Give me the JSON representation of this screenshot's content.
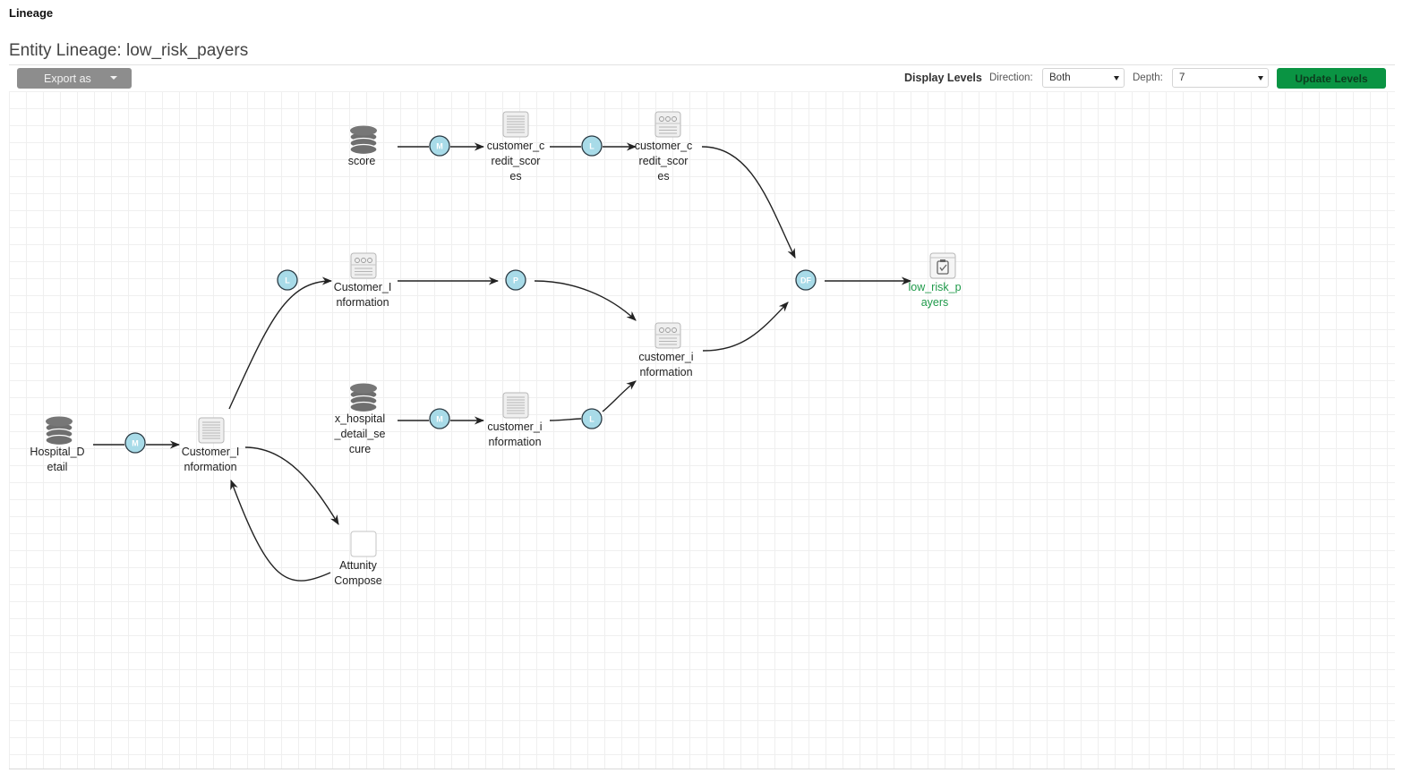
{
  "header": {
    "section_title": "Lineage",
    "page_title": "Entity Lineage: low_risk_payers"
  },
  "toolbar": {
    "export_label": "Export as",
    "display_levels_label": "Display Levels",
    "direction_label": "Direction:",
    "direction_value": "Both",
    "depth_label": "Depth:",
    "depth_value": "7",
    "update_label": "Update Levels"
  },
  "colors": {
    "process_fill": "#a8dbe8",
    "target_text": "#1f9a4a",
    "update_button": "#0a9443",
    "export_button": "#8d8d8d"
  },
  "graph": {
    "entities": [
      {
        "id": "score",
        "icon": "database-icon",
        "lines": [
          "score"
        ]
      },
      {
        "id": "ccs1",
        "icon": "table-icon",
        "lines": [
          "customer_c",
          "redit_scor",
          "es"
        ]
      },
      {
        "id": "ccs2",
        "icon": "view-icon",
        "lines": [
          "customer_c",
          "redit_scor",
          "es"
        ]
      },
      {
        "id": "ci_top",
        "icon": "view-icon",
        "lines": [
          "Customer_I",
          "nformation"
        ]
      },
      {
        "id": "ci_mid",
        "icon": "view-icon",
        "lines": [
          "customer_i",
          "nformation"
        ]
      },
      {
        "id": "low_risk",
        "icon": "report-icon",
        "lines": [
          "low_risk_p",
          "ayers"
        ],
        "target": true
      },
      {
        "id": "hosp",
        "icon": "database-icon",
        "lines": [
          "Hospital_D",
          "etail"
        ]
      },
      {
        "id": "ci_left",
        "icon": "table-icon",
        "lines": [
          "Customer_I",
          "nformation"
        ]
      },
      {
        "id": "xhosp",
        "icon": "database-icon",
        "lines": [
          "x_hospital",
          "_detail_se",
          "cure"
        ]
      },
      {
        "id": "ci_low",
        "icon": "table-icon",
        "lines": [
          "customer_i",
          "nformation"
        ]
      },
      {
        "id": "attunity",
        "icon": "blank-icon",
        "lines": [
          "Attunity",
          "Compose"
        ]
      }
    ],
    "processes": [
      {
        "id": "p_m1",
        "letter": "M"
      },
      {
        "id": "p_l1",
        "letter": "L"
      },
      {
        "id": "p_l2",
        "letter": "L"
      },
      {
        "id": "p_p",
        "letter": "P"
      },
      {
        "id": "p_df",
        "letter": "DF"
      },
      {
        "id": "p_m2",
        "letter": "M"
      },
      {
        "id": "p_m3",
        "letter": "M"
      },
      {
        "id": "p_l3",
        "letter": "L"
      }
    ],
    "edges": [
      [
        "score",
        "p_m1"
      ],
      [
        "p_m1",
        "ccs1"
      ],
      [
        "ccs1",
        "p_l1"
      ],
      [
        "p_l1",
        "ccs2"
      ],
      [
        "ccs2",
        "p_df"
      ],
      [
        "ci_left",
        "ci_top"
      ],
      [
        "ci_top",
        "p_p"
      ],
      [
        "p_p",
        "ci_mid"
      ],
      [
        "ci_mid",
        "p_df"
      ],
      [
        "p_df",
        "low_risk"
      ],
      [
        "hosp",
        "p_m2"
      ],
      [
        "p_m2",
        "ci_left"
      ],
      [
        "xhosp",
        "p_m3"
      ],
      [
        "p_m3",
        "ci_low"
      ],
      [
        "ci_low",
        "p_l3"
      ],
      [
        "p_l3",
        "ci_mid"
      ],
      [
        "ci_left",
        "attunity"
      ],
      [
        "attunity",
        "ci_left"
      ]
    ]
  }
}
